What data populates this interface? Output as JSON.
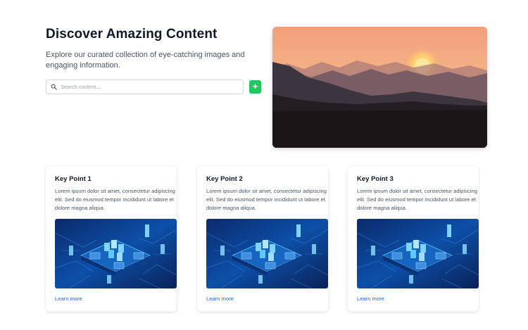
{
  "hero": {
    "title": "Discover Amazing Content",
    "description": "Explore our curated collection of eye-catching images and engaging information.",
    "search_placeholder": "Search content...",
    "add_label": "+"
  },
  "cards": [
    {
      "title": "Key Point 1",
      "text": "Lorem ipsum dolor sit amet, consectetur adipiscing elit. Sed do eiusmod tempor incididunt ut labore et dolore magna aliqua.",
      "link": "Learn more"
    },
    {
      "title": "Key Point 2",
      "text": "Lorem ipsum dolor sit amet, consectetur adipiscing elit. Sed do eiusmod tempor incididunt ut labore et dolore magna aliqua.",
      "link": "Learn more"
    },
    {
      "title": "Key Point 3",
      "text": "Lorem ipsum dolor sit amet, consectetur adipiscing elit. Sed do eiusmod tempor incididunt ut labore et dolore magna aliqua.",
      "link": "Learn more"
    }
  ],
  "colors": {
    "accent_green": "#22c55e",
    "link_blue": "#2563eb"
  },
  "icons": {
    "search": "search-icon",
    "add": "plus-icon"
  }
}
